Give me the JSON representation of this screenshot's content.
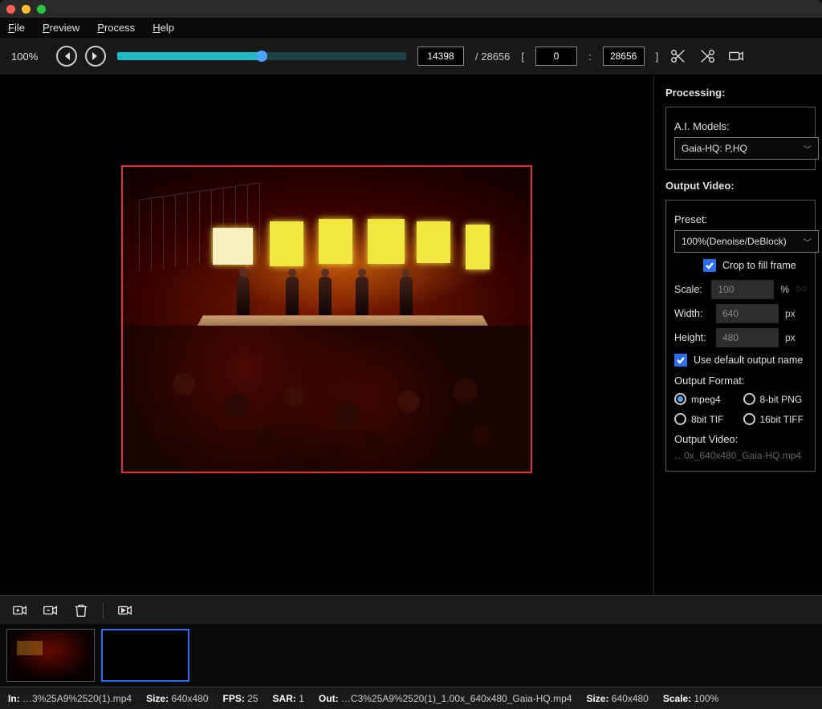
{
  "menu": {
    "file": "File",
    "preview": "Preview",
    "process": "Process",
    "help": "Help"
  },
  "toolbar": {
    "zoom": "100%",
    "slider_percent": 50,
    "current_frame": "14398",
    "total_frames": "28656",
    "range_start": "0",
    "range_end": "28656"
  },
  "icons": {
    "prev": "skip-back-icon",
    "next": "skip-forward-icon",
    "scissors": "scissors-icon",
    "cut": "cut-icon",
    "camera": "camera-icon"
  },
  "side": {
    "processing_heading": "Processing:",
    "ai_models_label": "A.I. Models:",
    "ai_models_value": "Gaia-HQ: P,HQ",
    "output_heading": "Output Video:",
    "preset_label": "Preset:",
    "preset_value": "100%(Denoise/DeBlock)",
    "crop_label": "Crop to fill frame",
    "scale_label": "Scale:",
    "scale_value": "100",
    "scale_unit": "%",
    "width_label": "Width:",
    "width_value": "640",
    "height_label": "Height:",
    "height_value": "480",
    "px_unit": "px",
    "default_name_label": "Use default output name",
    "format_label": "Output Format:",
    "formats": [
      "mpeg4",
      "8-bit PNG",
      "8bit TIF",
      "16bit TIFF"
    ],
    "format_selected": 0,
    "output_video_label": "Output Video:",
    "output_path": "…0x_640x480_Gaia-HQ.mp4"
  },
  "queue": {
    "add": "add-camera-icon",
    "remove": "remove-camera-icon",
    "trash": "trash-icon",
    "process": "process-camera-icon"
  },
  "status": {
    "in_label": "In:",
    "in_file": "…3%25A9%2520(1).mp4",
    "size1_label": "Size:",
    "size1": "640x480",
    "fps_label": "FPS:",
    "fps": "25",
    "sar_label": "SAR:",
    "sar": "1",
    "out_label": "Out:",
    "out_file": "…C3%25A9%2520(1)_1.00x_640x480_Gaia-HQ.mp4",
    "size2_label": "Size:",
    "size2": "640x480",
    "scale_label": "Scale:",
    "scale": "100%"
  }
}
